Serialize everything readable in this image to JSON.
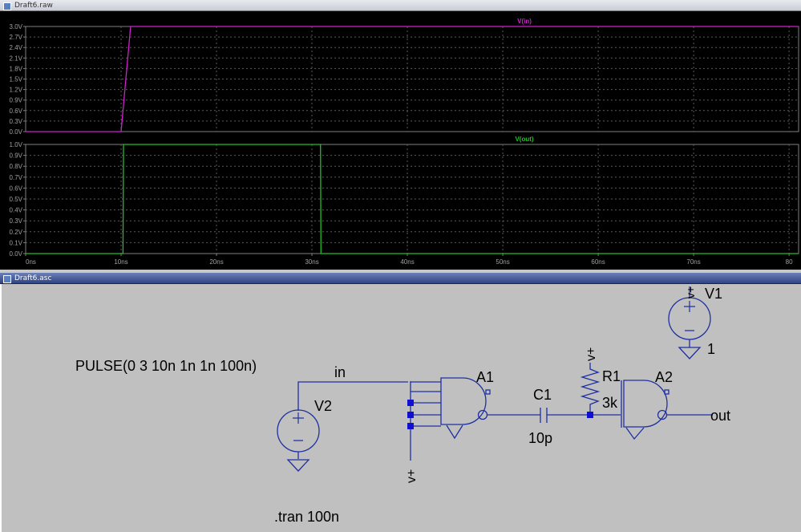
{
  "waveform_window": {
    "title": "Draft6.raw",
    "colors": {
      "background": "#000000",
      "grid": "#5a5a5a",
      "axis_text": "#a0a0a0",
      "in_trace": "#d020d0",
      "out_trace": "#20c020"
    },
    "x_ticks": [
      "0ns",
      "10ns",
      "20ns",
      "30ns",
      "40ns",
      "50ns",
      "60ns",
      "70ns",
      "80"
    ],
    "panes": [
      {
        "trace_label": "V(in)",
        "y_ticks": [
          "3.0V",
          "2.7V",
          "2.4V",
          "2.1V",
          "1.8V",
          "1.5V",
          "1.2V",
          "0.9V",
          "0.6V",
          "0.3V",
          "0.0V"
        ]
      },
      {
        "trace_label": "V(out)",
        "y_ticks": [
          "1.0V",
          "0.9V",
          "0.8V",
          "0.7V",
          "0.6V",
          "0.5V",
          "0.4V",
          "0.3V",
          "0.2V",
          "0.1V",
          "0.0V"
        ]
      }
    ]
  },
  "chart_data": [
    {
      "type": "line",
      "title": "",
      "xlabel": "",
      "ylabel": "",
      "xlim": [
        0,
        81
      ],
      "ylim": [
        0,
        3.0
      ],
      "grid": true,
      "series": [
        {
          "name": "V(in)",
          "x": [
            0,
            10,
            11,
            81
          ],
          "y": [
            0,
            0,
            3.0,
            3.0
          ]
        }
      ]
    },
    {
      "type": "line",
      "title": "",
      "xlabel": "",
      "ylabel": "",
      "xlim": [
        0,
        81
      ],
      "ylim": [
        0,
        1.0
      ],
      "grid": true,
      "series": [
        {
          "name": "V(out)",
          "x": [
            0,
            10.2,
            10.25,
            30.9,
            30.95,
            81
          ],
          "y": [
            0,
            0,
            1.0,
            1.0,
            0,
            0
          ]
        }
      ]
    }
  ],
  "schematic_window": {
    "title": "Draft6.asc",
    "colors": {
      "background": "#c0c0c0",
      "wire": "#2030a0",
      "junction": "#1010d0",
      "text": "#000000"
    },
    "labels": {
      "pulse": "PULSE(0 3 10n 1n 1n 100n)",
      "net_in": "in",
      "v2": "V2",
      "a1": "A1",
      "c1": "C1",
      "c1_value": "10p",
      "r1": "R1",
      "r1_value": "3k",
      "a2": "A2",
      "net_out": "out",
      "v1": "V1",
      "v1_value": "1",
      "vplus_a1": "v+",
      "vplus_r1": "v+",
      "vplus_v1": "v+",
      "directive": ".tran 100n"
    }
  }
}
